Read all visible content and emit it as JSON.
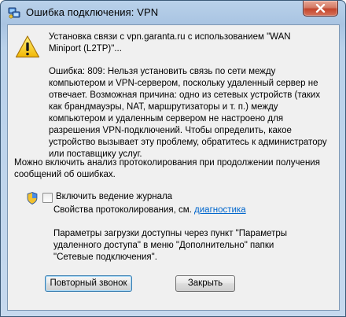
{
  "window": {
    "title": "Ошибка подключения: VPN"
  },
  "message": {
    "connecting": "Установка связи с vpn.garanta.ru с использованием \"WAN Miniport (L2TP)\"...",
    "error": "Ошибка: 809: Нельзя установить связь по сети между компьютером и VPN-сервером, поскольку удаленный сервер не отвечает. Возможная причина: одно из сетевых устройств (таких как брандмауэры, NAT, маршрутизаторы и т. п.) между компьютером и удаленным сервером не настроено для разрешения VPN-подключений. Чтобы определить, какое устройство вызывает эту проблему, обратитесь к администратору или поставщику услуг.",
    "logging_hint": "Можно включить анализ протоколирования при продолжении получения сообщений об ошибках."
  },
  "logging": {
    "checkbox_label": "Включить ведение журнала",
    "checked": false,
    "diagnostics_prefix": "Свойства протоколирования, см.",
    "diagnostics_link": "диагностика"
  },
  "footer_note": "Параметры загрузки доступны через пункт \"Параметры удаленного доступа\" в меню \"Дополнительно\" папки \"Сетевые подключения\".",
  "buttons": {
    "retry": "Повторный звонок",
    "close": "Закрыть"
  },
  "icons": {
    "app": "network-icon",
    "warning": "warning-icon",
    "uac": "shield-icon",
    "close": "close-icon"
  }
}
